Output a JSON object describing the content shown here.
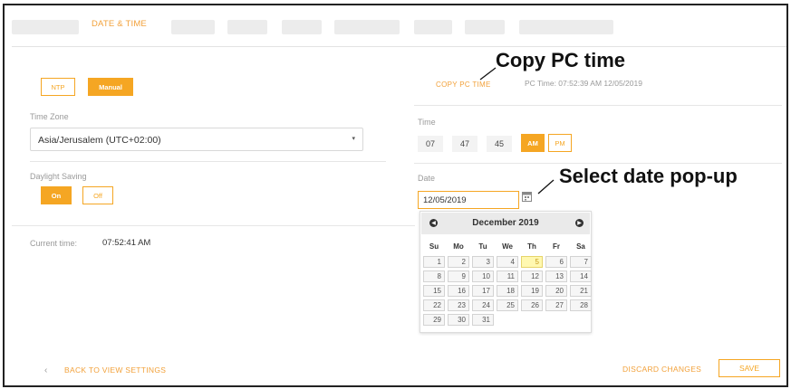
{
  "tabs": {
    "active_label": "DATE & TIME"
  },
  "mode": {
    "ntp_label": "NTP",
    "manual_label": "Manual"
  },
  "timezone": {
    "label": "Time Zone",
    "value": "Asia/Jerusalem (UTC+02:00)"
  },
  "daylight": {
    "label": "Daylight Saving",
    "on_label": "On",
    "off_label": "Off"
  },
  "current": {
    "label": "Current time:",
    "value": "07:52:41 AM"
  },
  "copy_pc": {
    "label": "COPY PC TIME",
    "pc_time": "PC Time: 07:52:39 AM 12/05/2019"
  },
  "time": {
    "label": "Time",
    "hour": "07",
    "minute": "47",
    "second": "45",
    "am_label": "AM",
    "pm_label": "PM"
  },
  "date": {
    "label": "Date",
    "value": "12/05/2019"
  },
  "calendar": {
    "month_title": "December 2019",
    "weekdays": [
      "Su",
      "Mo",
      "Tu",
      "We",
      "Th",
      "Fr",
      "Sa"
    ],
    "weeks": [
      [
        "1",
        "2",
        "3",
        "4",
        "5",
        "6",
        "7"
      ],
      [
        "8",
        "9",
        "10",
        "11",
        "12",
        "13",
        "14"
      ],
      [
        "15",
        "16",
        "17",
        "18",
        "19",
        "20",
        "21"
      ],
      [
        "22",
        "23",
        "24",
        "25",
        "26",
        "27",
        "28"
      ],
      [
        "29",
        "30",
        "31"
      ]
    ],
    "selected_day": "5"
  },
  "annotations": {
    "copy_pc": "Copy PC time",
    "select_date": "Select date pop-up"
  },
  "footer": {
    "back_label": "BACK TO VIEW SETTINGS",
    "discard_label": "DISCARD CHANGES",
    "save_label": "SAVE"
  },
  "colors": {
    "accent": "#f5a623",
    "today_bg": "#fff8b0"
  }
}
